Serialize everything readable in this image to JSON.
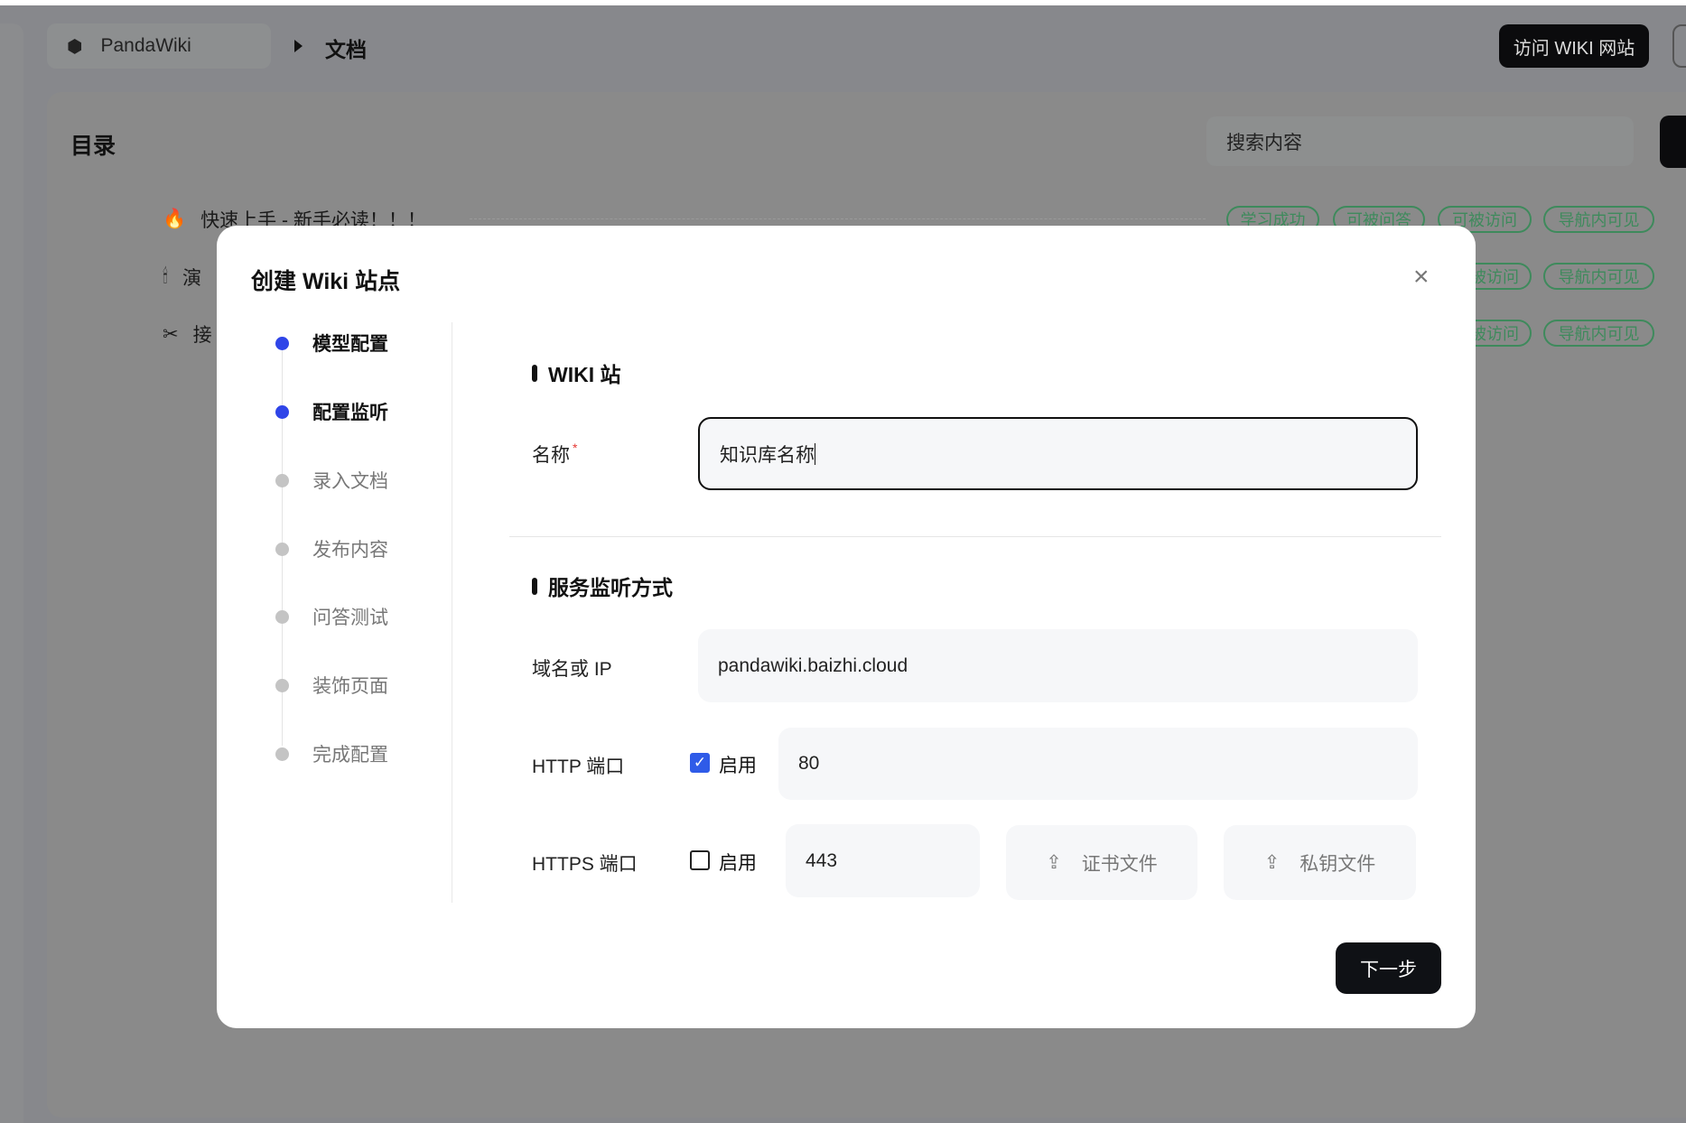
{
  "header": {
    "app_name": "PandaWiki",
    "breadcrumb": "文档",
    "visit_button": "访问 WIKI 网站"
  },
  "sidebar": {
    "title": "目录",
    "search_placeholder": "搜索内容"
  },
  "docs": [
    {
      "icon": "🔥",
      "title": "快速上手 - 新手必读！！！",
      "tags": [
        "学习成功",
        "可被问答",
        "可被访问",
        "导航内可见"
      ]
    },
    {
      "icon": "🕯",
      "title": "演",
      "tags": [
        "被访问",
        "导航内可见"
      ]
    },
    {
      "icon": "✂",
      "title": "接",
      "tags": [
        "被访问",
        "导航内可见"
      ]
    }
  ],
  "modal": {
    "title": "创建 Wiki 站点",
    "steps": [
      {
        "label": "模型配置",
        "done": true
      },
      {
        "label": "配置监听",
        "done": true
      },
      {
        "label": "录入文档",
        "done": false
      },
      {
        "label": "发布内容",
        "done": false
      },
      {
        "label": "问答测试",
        "done": false
      },
      {
        "label": "装饰页面",
        "done": false
      },
      {
        "label": "完成配置",
        "done": false
      }
    ],
    "wiki_section": "WIKI 站",
    "name_label": "名称",
    "required_mark": "*",
    "name_value": "知识库名称",
    "service_section": "服务监听方式",
    "domain_label": "域名或 IP",
    "domain_value": "pandawiki.baizhi.cloud",
    "http_label": "HTTP 端口",
    "http_enable": "启用",
    "http_checked": true,
    "http_port": "80",
    "https_label": "HTTPS 端口",
    "https_enable": "启用",
    "https_checked": false,
    "https_port": "443",
    "cert_button": "证书文件",
    "key_button": "私钥文件",
    "next_button": "下一步"
  }
}
